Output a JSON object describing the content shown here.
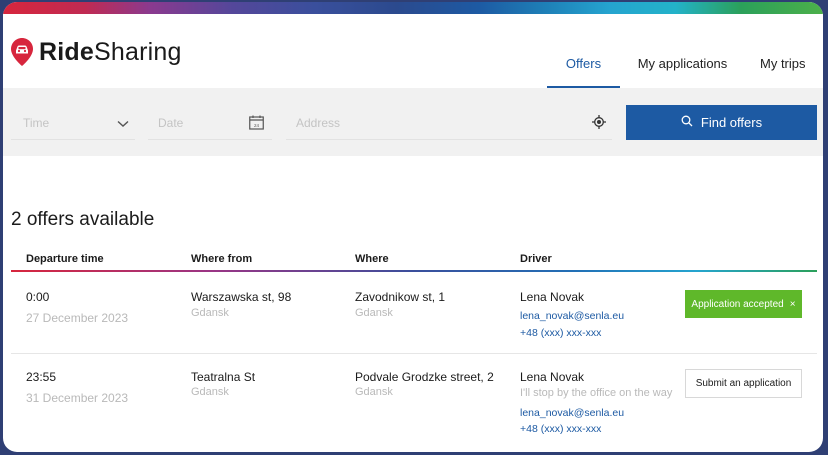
{
  "brand": {
    "bold": "Ride",
    "light": "Sharing",
    "color": "#d7263d"
  },
  "nav": {
    "items": [
      {
        "label": "Offers",
        "active": true
      },
      {
        "label": "My applications",
        "active": false
      },
      {
        "label": "My trips",
        "active": false
      }
    ]
  },
  "search": {
    "time_placeholder": "Time",
    "date_placeholder": "Date",
    "address_placeholder": "Address",
    "find_label": "Find offers",
    "calendar_day": "24"
  },
  "results": {
    "count_label": "2 offers available",
    "columns": [
      "Departure time",
      "Where from",
      "Where",
      "Driver"
    ],
    "rows": [
      {
        "time": "0:00",
        "date": "27 December 2023",
        "from": "Warszawska st, 98",
        "from_city": "Gdansk",
        "to": "Zavodnikow st, 1",
        "to_city": "Gdansk",
        "driver": "Lena Novak",
        "note": "",
        "email": "lena_novak@senla.eu",
        "phone": "+48 (xxx) xxx-xxx",
        "action": "Application accepted",
        "action_close": "×"
      },
      {
        "time": "23:55",
        "date": "31 December 2023",
        "from": "Teatralna St",
        "from_city": "Gdansk",
        "to": "Podvale Grodzke street, 2",
        "to_city": "Gdansk",
        "driver": "Lena Novak",
        "note": "I'll stop by the office on the way",
        "email": "lena_novak@senla.eu",
        "phone": "+48 (xxx) xxx-xxx",
        "action": "Submit an application"
      }
    ]
  },
  "colors": {
    "primary": "#1d5aa3",
    "accepted": "#5fb82a"
  }
}
